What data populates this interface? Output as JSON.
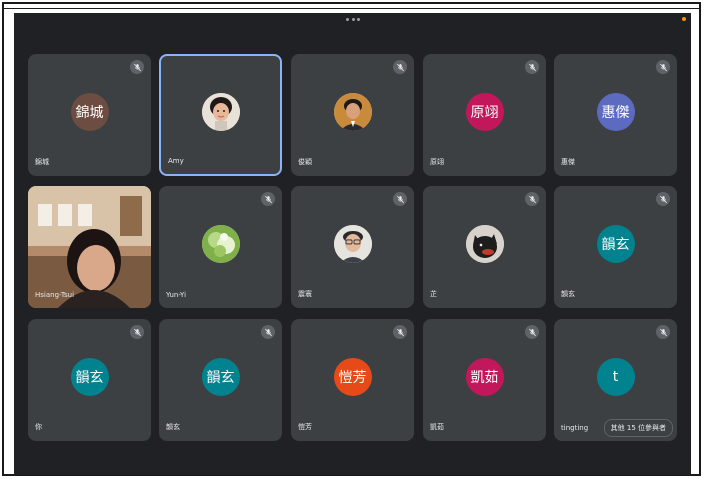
{
  "tiles": [
    {
      "name": "錦城",
      "initials": "錦城",
      "color": "#6d4c41",
      "type": "initials",
      "muted": true
    },
    {
      "name": "Amy",
      "type": "photo",
      "photo": "woman-face",
      "muted": false,
      "active": true
    },
    {
      "name": "俊穎",
      "type": "photo",
      "photo": "man-face",
      "muted": true
    },
    {
      "name": "原翊",
      "initials": "原翊",
      "color": "#c2185b",
      "type": "initials",
      "muted": true
    },
    {
      "name": "惠傑",
      "initials": "惠傑",
      "color": "#5c6bc0",
      "type": "initials",
      "muted": true
    },
    {
      "name": "Hsiang-Tsui",
      "type": "video",
      "muted": false
    },
    {
      "name": "Yun-Yi",
      "type": "photo",
      "photo": "flower",
      "muted": true
    },
    {
      "name": "震寰",
      "type": "photo",
      "photo": "man-glasses",
      "muted": true
    },
    {
      "name": "芷",
      "type": "photo",
      "photo": "dog",
      "muted": true
    },
    {
      "name": "韻玄",
      "initials": "韻玄",
      "color": "#00838f",
      "type": "initials",
      "muted": true
    },
    {
      "name": "你",
      "initials": "韻玄",
      "color": "#00838f",
      "type": "initials",
      "muted": true
    },
    {
      "name": "韻玄",
      "initials": "韻玄",
      "color": "#00838f",
      "type": "initials",
      "muted": true
    },
    {
      "name": "愷芳",
      "initials": "愷芳",
      "color": "#e64a19",
      "type": "initials",
      "muted": true
    },
    {
      "name": "凱茹",
      "initials": "凱茹",
      "color": "#c2185b",
      "type": "initials",
      "muted": true
    },
    {
      "name": "tingting",
      "initials": "t",
      "color": "#00838f",
      "type": "initials",
      "muted": true
    }
  ],
  "more_participants_label": "其他 15 位參與者",
  "colors": {
    "background": "#202124",
    "tile": "#3c4043",
    "active_border": "#8ab4f8"
  }
}
